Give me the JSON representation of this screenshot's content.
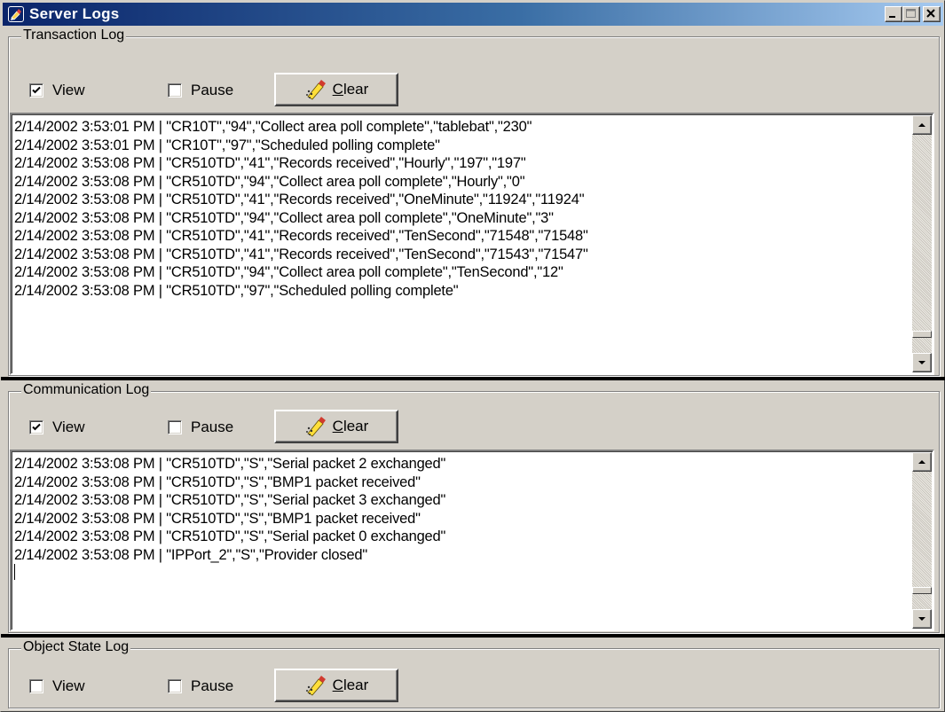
{
  "window": {
    "title": "Server Logs",
    "icon": "app-icon",
    "controls": [
      "minimize-icon",
      "maximize-icon",
      "close-icon"
    ]
  },
  "transaction_log": {
    "label": "Transaction Log",
    "view_label": "View",
    "view_checked": true,
    "pause_label": "Pause",
    "pause_checked": false,
    "clear_label": "Clear",
    "clear_mnemonic": "C",
    "clear_rest": "lear",
    "lines": [
      "2/14/2002 3:53:01 PM | \"CR10T\",\"94\",\"Collect area poll complete\",\"tablebat\",\"230\"",
      "2/14/2002 3:53:01 PM | \"CR10T\",\"97\",\"Scheduled polling complete\"",
      "2/14/2002 3:53:08 PM | \"CR510TD\",\"41\",\"Records received\",\"Hourly\",\"197\",\"197\"",
      "2/14/2002 3:53:08 PM | \"CR510TD\",\"94\",\"Collect area poll complete\",\"Hourly\",\"0\"",
      "2/14/2002 3:53:08 PM | \"CR510TD\",\"41\",\"Records received\",\"OneMinute\",\"11924\",\"11924\"",
      "2/14/2002 3:53:08 PM | \"CR510TD\",\"94\",\"Collect area poll complete\",\"OneMinute\",\"3\"",
      "2/14/2002 3:53:08 PM | \"CR510TD\",\"41\",\"Records received\",\"TenSecond\",\"71548\",\"71548\"",
      "2/14/2002 3:53:08 PM | \"CR510TD\",\"41\",\"Records received\",\"TenSecond\",\"71543\",\"71547\"",
      "2/14/2002 3:53:08 PM | \"CR510TD\",\"94\",\"Collect area poll complete\",\"TenSecond\",\"12\"",
      "2/14/2002 3:53:08 PM | \"CR510TD\",\"97\",\"Scheduled polling complete\""
    ]
  },
  "communication_log": {
    "label": "Communication Log",
    "view_label": "View",
    "view_checked": true,
    "pause_label": "Pause",
    "pause_checked": false,
    "clear_label": "Clear",
    "clear_mnemonic": "C",
    "clear_rest": "lear",
    "lines": [
      "2/14/2002 3:53:08 PM | \"CR510TD\",\"S\",\"Serial packet 2 exchanged\"",
      "2/14/2002 3:53:08 PM | \"CR510TD\",\"S\",\"BMP1 packet received\"",
      "2/14/2002 3:53:08 PM | \"CR510TD\",\"S\",\"Serial packet 3 exchanged\"",
      "2/14/2002 3:53:08 PM | \"CR510TD\",\"S\",\"BMP1 packet received\"",
      "2/14/2002 3:53:08 PM | \"CR510TD\",\"S\",\"Serial packet 0 exchanged\"",
      "2/14/2002 3:53:08 PM | \"IPPort_2\",\"S\",\"Provider closed\""
    ]
  },
  "object_state_log": {
    "label": "Object State Log",
    "view_label": "View",
    "view_checked": false,
    "pause_label": "Pause",
    "pause_checked": false,
    "clear_label": "Clear",
    "clear_mnemonic": "C",
    "clear_rest": "lear"
  },
  "colors": {
    "titlebar_start": "#0a246a",
    "titlebar_end": "#a6caf0",
    "face": "#d4d0c8",
    "splitter": "#000000"
  },
  "icons": [
    "app-icon",
    "checkmark-icon",
    "eraser-icon",
    "scroll-up-arrow-icon",
    "scroll-down-arrow-icon"
  ]
}
